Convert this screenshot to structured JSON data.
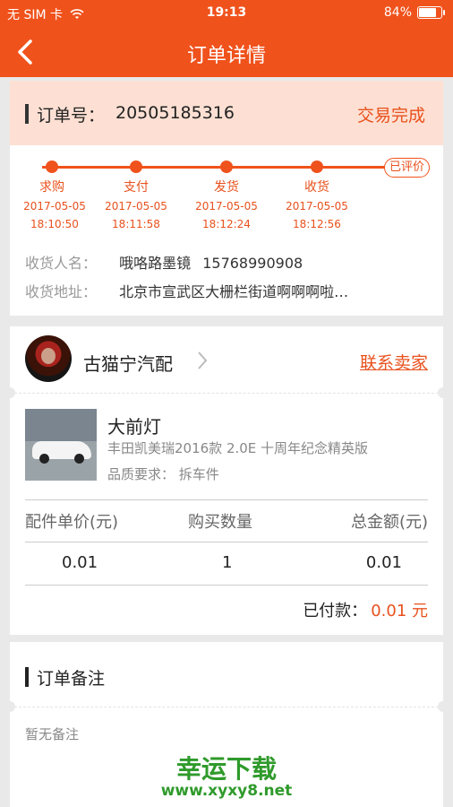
{
  "status_bar": {
    "carrier": "无 SIM 卡",
    "time": "19:13",
    "battery": "84%",
    "battery_level": 0.84
  },
  "nav": {
    "title": "订单详情",
    "back_icon": "chevron-left-icon"
  },
  "order": {
    "number_label": "订单号：",
    "number": "20505185316",
    "status": "交易完成",
    "steps": [
      {
        "label": "求购",
        "date": "2017-05-05",
        "time": "18:10:50"
      },
      {
        "label": "支付",
        "date": "2017-05-05",
        "time": "18:11:58"
      },
      {
        "label": "发货",
        "date": "2017-05-05",
        "time": "18:12:24"
      },
      {
        "label": "收货",
        "date": "2017-05-05",
        "time": "18:12:56"
      }
    ],
    "final_step": "已评价",
    "receiver_label": "收货人名：",
    "receiver_name": "哦咯路墨镜",
    "receiver_phone": "15768990908",
    "address_label": "收货地址：",
    "address": "北京市宣武区大栅栏街道啊啊啊啦…"
  },
  "seller": {
    "name": "古猫宁汽配",
    "contact": "联系卖家"
  },
  "product": {
    "title": "大前灯",
    "desc": "丰田凯美瑞2016款 2.0E 十周年纪念精英版",
    "req_label": "品质要求：",
    "req_value": "拆车件"
  },
  "table": {
    "headers": [
      "配件单价(元)",
      "购买数量",
      "总金额(元)"
    ],
    "row": [
      "0.01",
      "1",
      "0.01"
    ]
  },
  "payment": {
    "label": "已付款：",
    "amount": "0.01 元"
  },
  "note": {
    "title": "订单备注",
    "empty": "暂无备注"
  },
  "watermark": {
    "brand": "幸运下载",
    "url": "www.xyxy8.net"
  },
  "colors": {
    "accent": "#f0521c",
    "header_bg": "#fde0d3",
    "watermark": "#2f9a2b"
  }
}
